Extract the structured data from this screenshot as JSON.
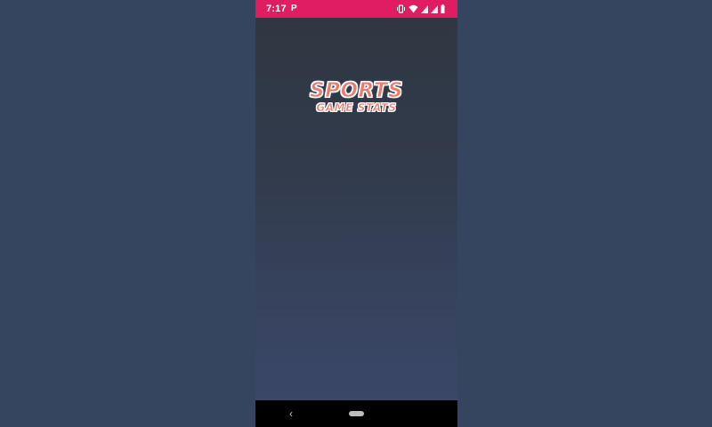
{
  "status_bar": {
    "time": "7:17",
    "app_icon": "P",
    "background_color": "#e01d62",
    "icons": [
      "vibrate-icon",
      "wifi-icon",
      "signal-icon",
      "signal-icon",
      "battery-icon"
    ]
  },
  "splash": {
    "logo_title": "SPORTS",
    "logo_subtitle": "GAME STATS",
    "logo_color": "#f07a6a"
  },
  "nav_bar": {
    "back_glyph": "‹",
    "icons": [
      "back-icon",
      "home-pill-icon"
    ]
  }
}
